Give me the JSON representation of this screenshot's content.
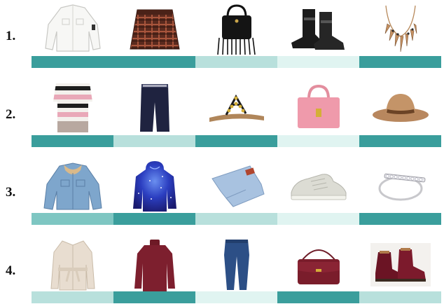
{
  "rows": [
    {
      "label": "1.",
      "items": [
        "white-cropped-jacket",
        "plaid-mini-skirt",
        "fringe-bucket-bag",
        "black-ankle-boots",
        "spike-statement-necklace"
      ],
      "bar_colors": [
        "#3a9e9c",
        "#3a9e9c",
        "#b8e0dc",
        "#e0f4f1",
        "#3a9e9c"
      ]
    },
    {
      "label": "2.",
      "items": [
        "striped-oversized-sweater",
        "navy-bermuda-shorts",
        "embellished-t-strap-sandals",
        "pink-tote-bag",
        "tan-floppy-hat"
      ],
      "bar_colors": [
        "#3a9e9c",
        "#b8e0dc",
        "#3a9e9c",
        "#e0f4f1",
        "#3a9e9c"
      ]
    },
    {
      "label": "3.",
      "items": [
        "sherpa-denim-jacket",
        "galaxy-print-hoodie",
        "light-wash-jeans",
        "grey-leather-sneakers",
        "diamond-bar-ring"
      ],
      "bar_colors": [
        "#7ec6c2",
        "#3a9e9c",
        "#b8e0dc",
        "#e0f4f1",
        "#3a9e9c"
      ]
    },
    {
      "label": "4.",
      "items": [
        "cream-belted-cardigan",
        "burgundy-turtleneck",
        "skinny-jeans",
        "burgundy-crossbody-bag",
        "burgundy-hiking-boots"
      ],
      "bar_colors": [
        "#b8e0dc",
        "#3a9e9c",
        "#e0f4f1",
        "#3a9e9c",
        "#b8e0dc"
      ]
    }
  ]
}
